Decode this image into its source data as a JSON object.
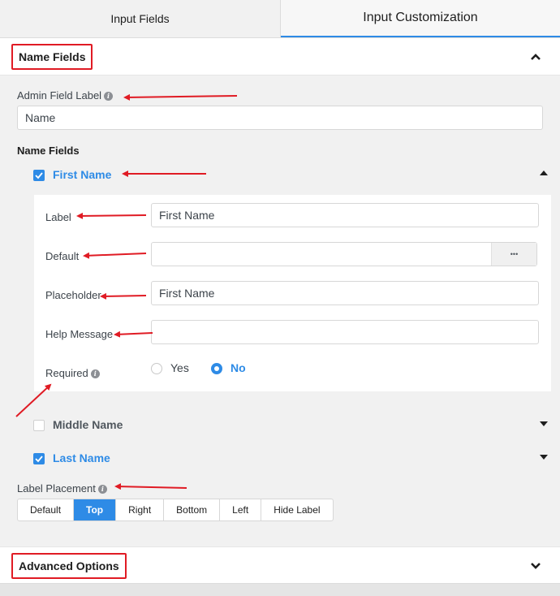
{
  "tabs": [
    "Input Fields",
    "Input Customization"
  ],
  "section_name_fields": {
    "title": "Name Fields"
  },
  "admin_field_label": {
    "label": "Admin Field Label",
    "value": "Name"
  },
  "name_fields_heading": "Name Fields",
  "first_name": {
    "label": "First Name",
    "checked": true,
    "props": {
      "label_label": "Label",
      "label_value": "First Name",
      "default_label": "Default",
      "default_value": "",
      "default_more": "•••",
      "placeholder_label": "Placeholder",
      "placeholder_value": "First Name",
      "help_label": "Help Message",
      "help_value": "",
      "required_label": "Required",
      "required_yes": "Yes",
      "required_no": "No",
      "required_selected": "No"
    }
  },
  "middle_name": {
    "label": "Middle Name",
    "checked": false
  },
  "last_name": {
    "label": "Last Name",
    "checked": true
  },
  "label_placement": {
    "label": "Label Placement",
    "options": [
      "Default",
      "Top",
      "Right",
      "Bottom",
      "Left",
      "Hide Label"
    ],
    "selected": "Top"
  },
  "section_advanced": {
    "title": "Advanced Options"
  },
  "colors": {
    "accent": "#2e8be6",
    "annotation": "#e01b24"
  }
}
